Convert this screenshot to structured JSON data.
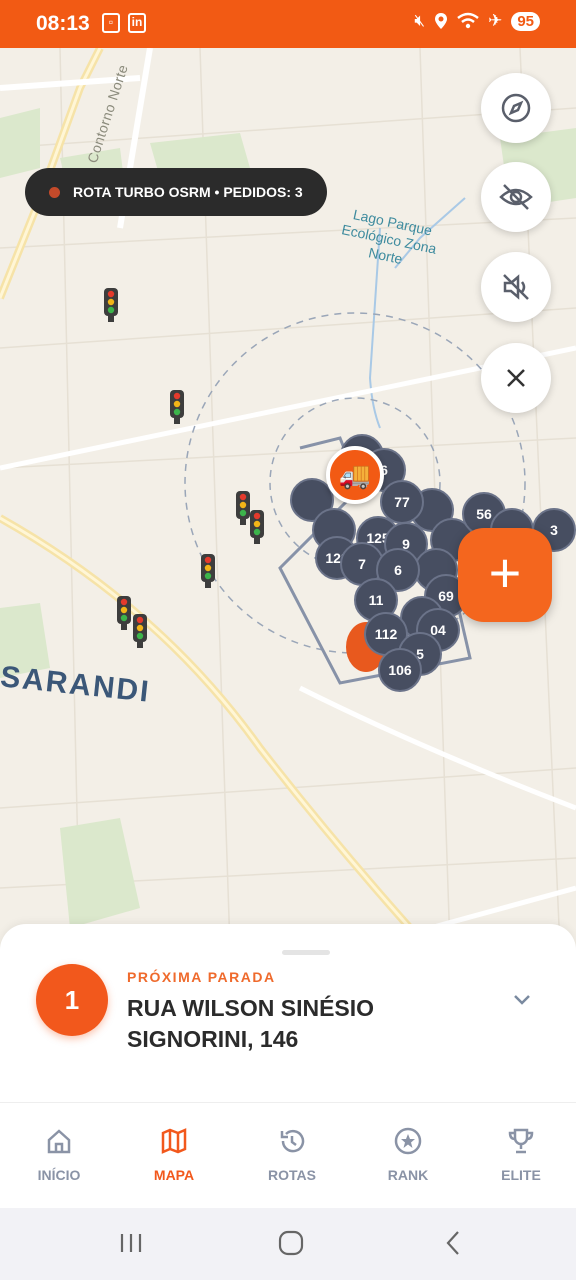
{
  "status_bar": {
    "time": "08:13",
    "battery": "95",
    "icons": [
      "screenshot-icon",
      "linkedin-icon",
      "mute-icon",
      "location-icon",
      "wifi-icon",
      "airplane-icon"
    ]
  },
  "map": {
    "road_label": "Contorno Norte",
    "lake_label": "Lago Parque Ecológico Zona Norte",
    "city_label": "SARANDI",
    "route_pill": "ROTA TURBO OSRM • PEDIDOS: 3",
    "cluster_labels": [
      "6",
      "77",
      "56",
      "3",
      "125",
      "9",
      "128",
      "7",
      "6",
      "11",
      "69",
      "112",
      "04",
      "5",
      "106"
    ],
    "buttons": [
      "compass-icon",
      "eye-off-icon",
      "volume-off-icon",
      "close-icon"
    ],
    "add_button": "+"
  },
  "next_stop": {
    "number": "1",
    "label": "PRÓXIMA PARADA",
    "address": "RUA WILSON SINÉSIO SIGNORINI, 146"
  },
  "nav": {
    "items": [
      {
        "label": "INÍCIO",
        "icon": "home-icon",
        "active": false
      },
      {
        "label": "MAPA",
        "icon": "map-icon",
        "active": true
      },
      {
        "label": "ROTAS",
        "icon": "history-icon",
        "active": false
      },
      {
        "label": "RANK",
        "icon": "star-badge-icon",
        "active": false
      },
      {
        "label": "ELITE",
        "icon": "trophy-icon",
        "active": false
      }
    ]
  },
  "colors": {
    "accent": "#f25a14",
    "cluster": "#474e61",
    "map_bg": "#f3efe7"
  }
}
